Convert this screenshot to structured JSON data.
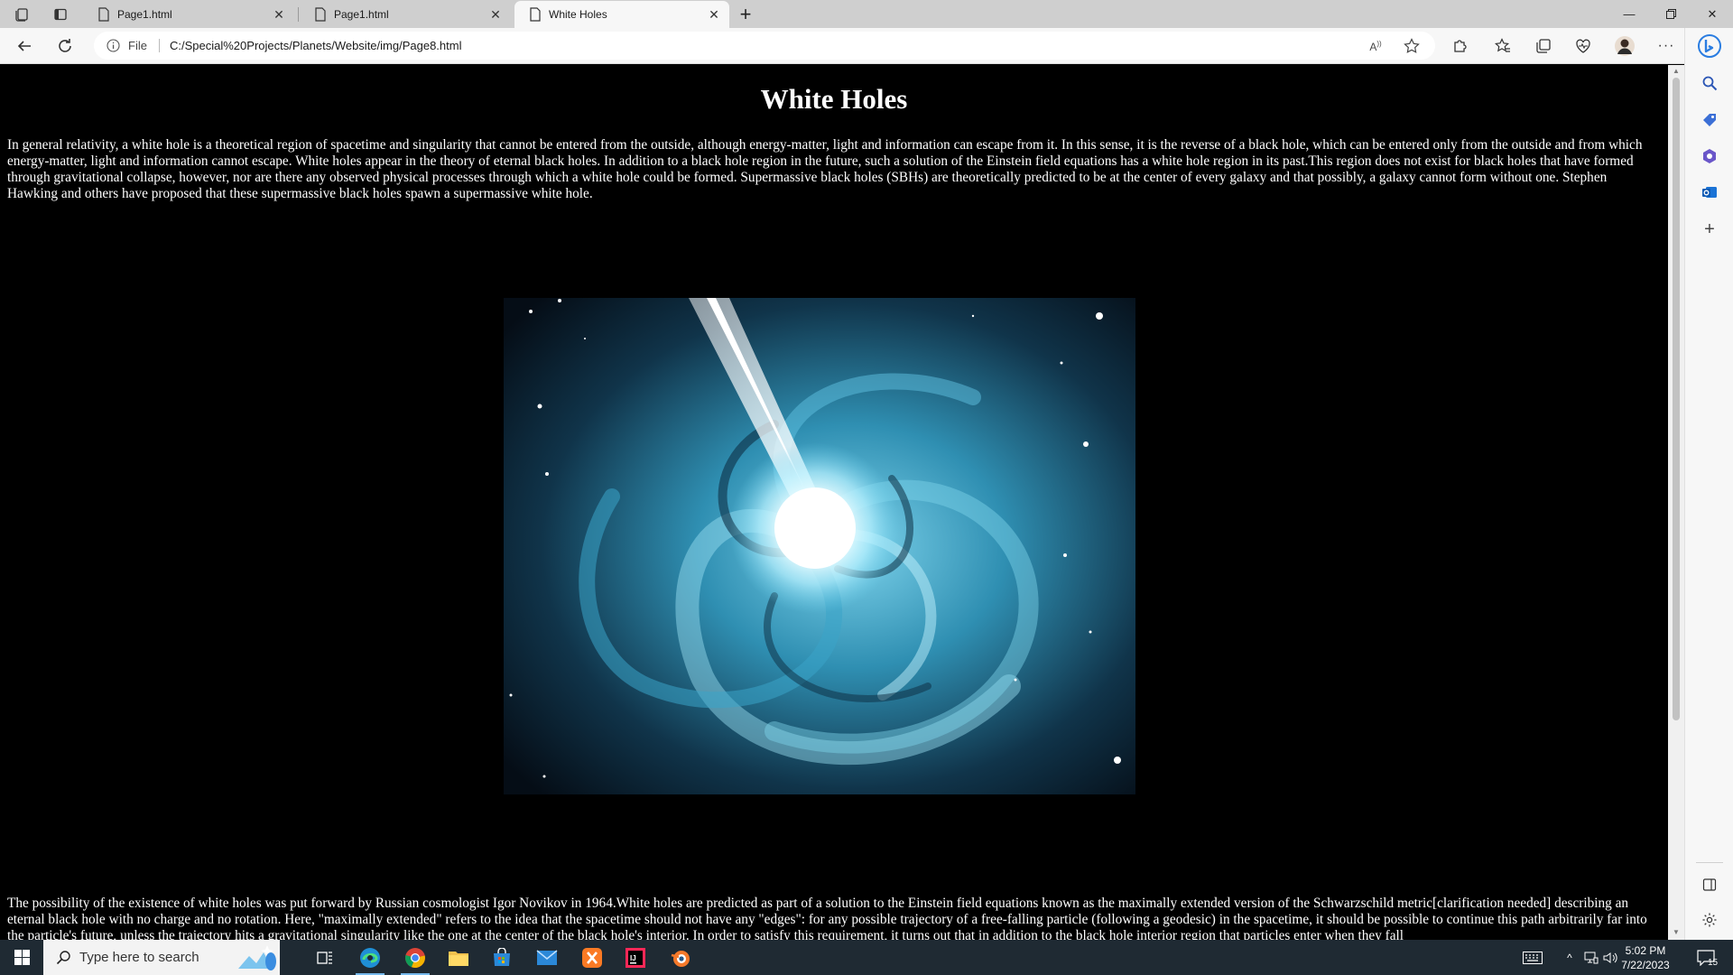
{
  "browser": {
    "tabs": [
      {
        "title": "Page1.html",
        "active": false
      },
      {
        "title": "Page1.html",
        "active": false
      },
      {
        "title": "White Holes",
        "active": true
      }
    ],
    "address": {
      "scheme_label": "File",
      "url": "C:/Special%20Projects/Planets/Website/img/Page8.html"
    }
  },
  "page": {
    "title": "White Holes",
    "paragraph1": "In general relativity, a white hole is a theoretical region of spacetime and singularity that cannot be entered from the outside, although energy-matter, light and information can escape from it. In this sense, it is the reverse of a black hole, which can be entered only from the outside and from which energy-matter, light and information cannot escape. White holes appear in the theory of eternal black holes. In addition to a black hole region in the future, such a solution of the Einstein field equations has a white hole region in its past.This region does not exist for black holes that have formed through gravitational collapse, however, nor are there any observed physical processes through which a white hole could be formed. Supermassive black holes (SBHs) are theoretically predicted to be at the center of every galaxy and that possibly, a galaxy cannot form without one. Stephen Hawking and others have proposed that these supermassive black holes spawn a supermassive white hole.",
    "paragraph2": "The possibility of the existence of white holes was put forward by Russian cosmologist Igor Novikov in 1964.White holes are predicted as part of a solution to the Einstein field equations known as the maximally extended version of the Schwarzschild metric[clarification needed] describing an eternal black hole with no charge and no rotation. Here, \"maximally extended\" refers to the idea that the spacetime should not have any \"edges\": for any possible trajectory of a free-falling particle (following a geodesic) in the spacetime, it should be possible to continue this path arbitrarily far into the particle's future, unless the trajectory hits a gravitational singularity like the one at the center of the black hole's interior. In order to satisfy this requirement, it turns out that in addition to the black hole interior region that particles enter when they fall"
  },
  "taskbar": {
    "search_placeholder": "Type here to search",
    "time": "5:02 PM",
    "date": "7/22/2023",
    "notification_count": "15"
  },
  "colors": {
    "page_bg": "#000000",
    "text": "#ffffff",
    "accent_cyan": "#5fc8e6",
    "taskbar_bg": "#1f2a33"
  }
}
